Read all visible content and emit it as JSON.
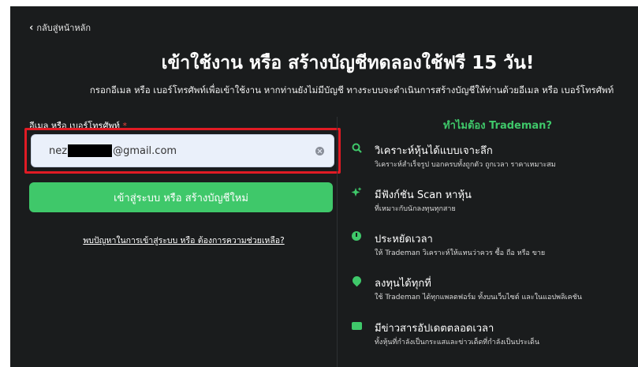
{
  "back_link": "กลับสู่หน้าหลัก",
  "title": "เข้าใช้งาน หรือ สร้างบัญชีทดลองใช้ฟรี 15 วัน!",
  "subtitle": "กรอกอีเมล หรือ เบอร์โทรศัพท์เพื่อเข้าใช้งาน หากท่านยังไม่มีบัญชี ทางระบบจะดำเนินการสร้างบัญชีให้ท่านด้วยอีเมล หรือ เบอร์โทรศัพท์",
  "form": {
    "label": "อีเมล หรือ เบอร์โทรศัพท์",
    "required_mark": "*",
    "value_prefix": "nez",
    "value_suffix": "@gmail.com",
    "submit_label": "เข้าสู่ระบบ หรือ สร้างบัญชีใหม่",
    "help_link": "พบปัญหาในการเข้าสู่ระบบ หรือ ต้องการความช่วยเหลือ?"
  },
  "why": {
    "title": "ทำไมต้อง Trademan?",
    "features": [
      {
        "icon": "search-icon",
        "title": "วิเคราะห์หุ้นได้แบบเจาะลึก",
        "desc": "วิเคราะห์สำเร็จรูป บอกครบทั้งถูกตัว ถูกเวลา ราคาเหมาะสม"
      },
      {
        "icon": "sparkle-icon",
        "title": "มีฟังก์ชัน Scan หาหุ้น",
        "desc": "ที่เหมาะกับนักลงทุนทุกสาย"
      },
      {
        "icon": "clock-icon",
        "title": "ประหยัดเวลา",
        "desc": "ให้ Trademan วิเคราะห์ให้แทนว่าควร ซื้อ ถือ หรือ ขาย"
      },
      {
        "icon": "location-pin-icon",
        "title": "ลงทุนได้ทุกที่",
        "desc": "ใช้ Trademan ได้ทุกแพลตฟอร์ม ทั้งบนเว็บไซต์ และในแอปพลิเคชัน"
      },
      {
        "icon": "newspaper-icon",
        "title": "มีข่าวสารอัปเดตตลอดเวลา",
        "desc": "ทั้งหุ้นที่กำลังเป็นกระแสและข่าวเด็ดที่กำลังเป็นประเด็น"
      }
    ]
  },
  "colors": {
    "background": "#1a1c1d",
    "accent": "#3fc86a",
    "highlight": "#e01b24",
    "input_bg": "#eaf0fa"
  }
}
